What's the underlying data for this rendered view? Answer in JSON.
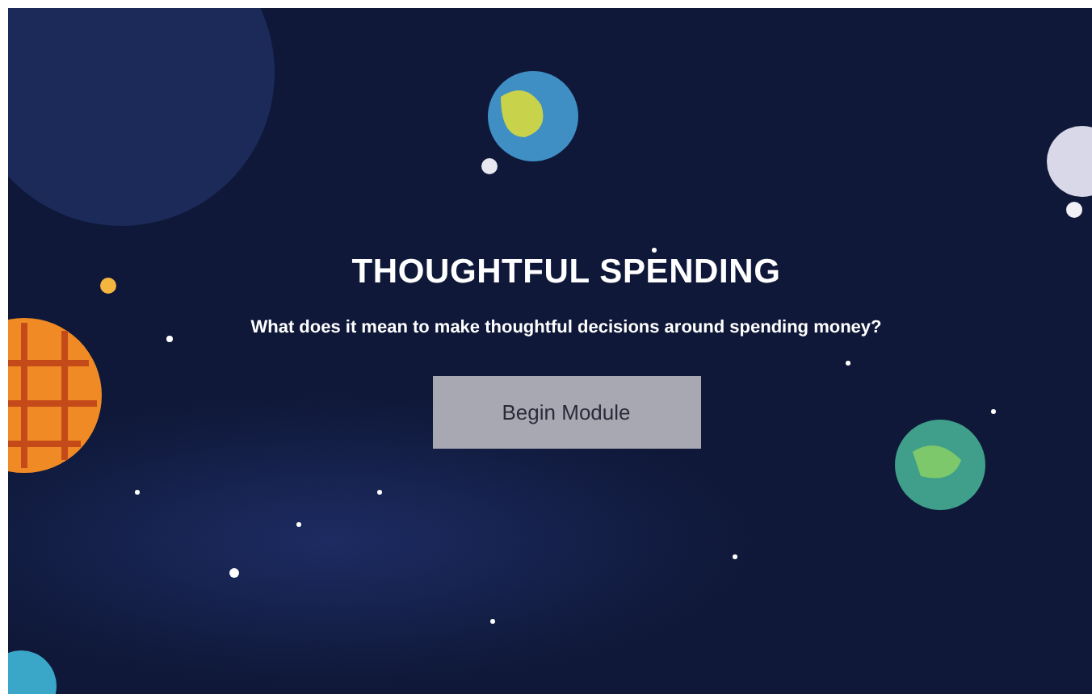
{
  "hero": {
    "title": "THOUGHTFUL SPENDING",
    "subtitle": "What does it mean to make thoughtful decisions around spending money?",
    "button": "Begin Module"
  }
}
